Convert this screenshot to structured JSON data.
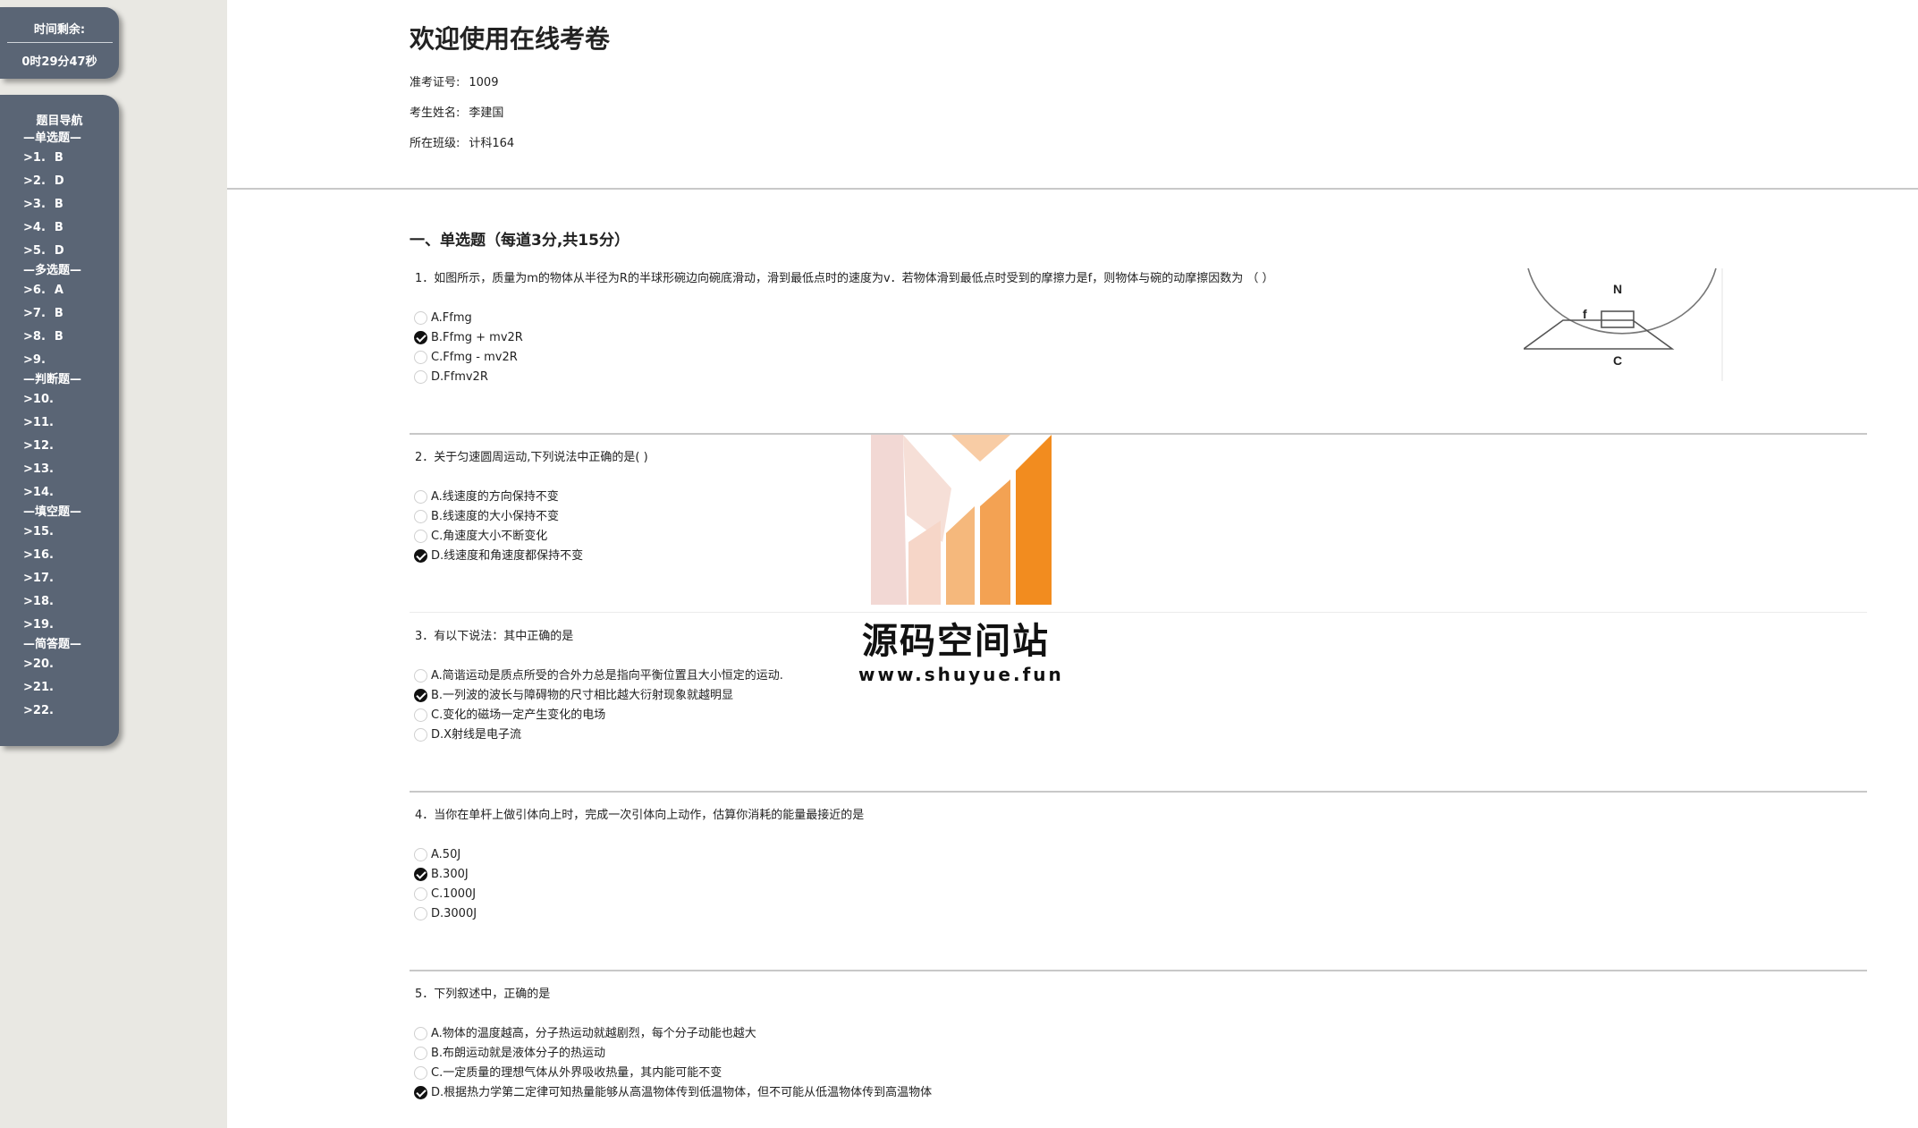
{
  "timer": {
    "label": "时间剩余:",
    "value": "0时29分47秒"
  },
  "nav": {
    "title": "题目导航",
    "sections": [
      {
        "label": "—单选题—",
        "items": [
          {
            "label": ">1.",
            "answer": "B"
          },
          {
            "label": ">2.",
            "answer": "D"
          },
          {
            "label": ">3.",
            "answer": "B"
          },
          {
            "label": ">4.",
            "answer": "B"
          },
          {
            "label": ">5.",
            "answer": "D"
          }
        ]
      },
      {
        "label": "—多选题—",
        "items": [
          {
            "label": ">6.",
            "answer": "A"
          },
          {
            "label": ">7.",
            "answer": "B"
          },
          {
            "label": ">8.",
            "answer": "B"
          },
          {
            "label": ">9.",
            "answer": ""
          }
        ]
      },
      {
        "label": "—判断题—",
        "items": [
          {
            "label": ">10.",
            "answer": ""
          },
          {
            "label": ">11.",
            "answer": ""
          },
          {
            "label": ">12.",
            "answer": ""
          },
          {
            "label": ">13.",
            "answer": ""
          },
          {
            "label": ">14.",
            "answer": ""
          }
        ]
      },
      {
        "label": "—填空题—",
        "items": [
          {
            "label": ">15.",
            "answer": ""
          },
          {
            "label": ">16.",
            "answer": ""
          },
          {
            "label": ">17.",
            "answer": ""
          },
          {
            "label": ">18.",
            "answer": ""
          },
          {
            "label": ">19.",
            "answer": ""
          }
        ]
      },
      {
        "label": "—简答题—",
        "items": [
          {
            "label": ">20.",
            "answer": ""
          },
          {
            "label": ">21.",
            "answer": ""
          },
          {
            "label": ">22.",
            "answer": ""
          }
        ]
      }
    ]
  },
  "header": {
    "title": "欢迎使用在线考卷",
    "exam_id_label": "准考证号:",
    "exam_id": "1009",
    "name_label": "考生姓名:",
    "name": "李建国",
    "class_label": "所在班级:",
    "class": "计科164"
  },
  "section_title": "一、单选题（每道3分,共15分）",
  "figure": {
    "label_n": "N",
    "label_f": "f",
    "label_c": "C"
  },
  "questions": [
    {
      "text": "1．如图所示，质量为m的物体从半径为R的半球形碗边向碗底滑动，滑到最低点时的速度为v．若物体滑到最低点时受到的摩擦力是f，则物体与碗的动摩擦因数为 （ ）",
      "options": [
        "A.Ffmg",
        "B.Ffmg + mv2R",
        "C.Ffmg - mv2R",
        "D.Ffmv2R"
      ],
      "selected": 1
    },
    {
      "text": "2．关于匀速圆周运动,下列说法中正确的是( )",
      "options": [
        "A.线速度的方向保持不变",
        "B.线速度的大小保持不变",
        "C.角速度大小不断变化",
        "D.线速度和角速度都保持不变"
      ],
      "selected": 3
    },
    {
      "text": "3．有以下说法：其中正确的是",
      "options": [
        "A.简谐运动是质点所受的合外力总是指向平衡位置且大小恒定的运动.",
        "B.一列波的波长与障碍物的尺寸相比越大衍射现象就越明显",
        "C.变化的磁场一定产生变化的电场",
        "D.X射线是电子流"
      ],
      "selected": 1
    },
    {
      "text": "4．当你在单杆上做引体向上时，完成一次引体向上动作，估算你消耗的能量最接近的是",
      "options": [
        "A.50J",
        "B.300J",
        "C.1000J",
        "D.3000J"
      ],
      "selected": 1
    },
    {
      "text": "5．下列叙述中，正确的是",
      "options": [
        "A.物体的温度越高，分子热运动就越剧烈，每个分子动能也越大",
        "B.布朗运动就是液体分子的热运动",
        "C.一定质量的理想气体从外界吸收热量，其内能可能不变",
        "D.根据热力学第二定律可知热量能够从高温物体传到低温物体，但不可能从低温物体传到高温物体"
      ],
      "selected": 3
    }
  ],
  "watermark": {
    "title": "源码空间站",
    "url": "www.shuyue.fun"
  },
  "colors": {
    "sidebar_panel": "#5a6575",
    "watermark_orange": "#f28c1f",
    "watermark_pink": "#f1d4cf"
  }
}
